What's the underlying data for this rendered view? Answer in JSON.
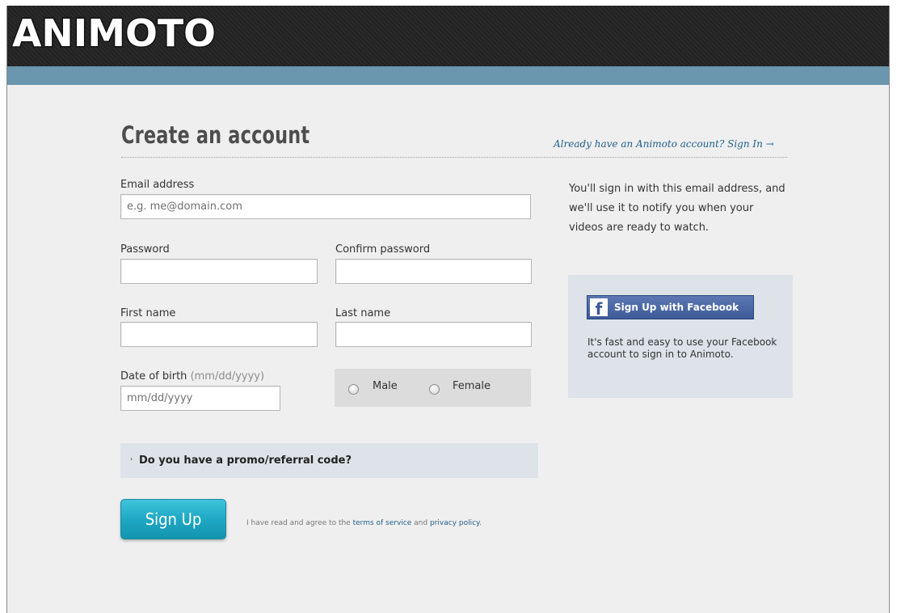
{
  "header": {
    "logo_text": "ANIMOTO"
  },
  "form": {
    "title": "Create an account",
    "signin_link": "Already have an Animoto account? Sign In →",
    "email": {
      "label": "Email address",
      "placeholder": "e.g. me@domain.com"
    },
    "password": {
      "label": "Password",
      "value": ""
    },
    "confirm_password": {
      "label": "Confirm password",
      "value": ""
    },
    "first_name": {
      "label": "First name",
      "value": ""
    },
    "last_name": {
      "label": "Last name",
      "value": ""
    },
    "dob": {
      "label": "Date of birth",
      "hint": "(mm/dd/yyyy)",
      "placeholder": "mm/dd/yyyy"
    },
    "gender": {
      "male": "Male",
      "female": "Female"
    },
    "promo": {
      "arrow": "›",
      "label": "Do you have a promo/referral code?"
    },
    "signup_button": "Sign Up",
    "agreement": {
      "prefix": "I have read and agree to the",
      "terms": "terms of service",
      "and": "and",
      "privacy": "privacy policy",
      "suffix": "."
    }
  },
  "sidebar": {
    "help_text": "You'll sign in with this email address, and we'll use it to notify you when your videos are ready to watch.",
    "facebook": {
      "icon": "facebook-icon",
      "button_label": "Sign Up with Facebook",
      "description": "It's fast and easy to use your Facebook account to sign in to Animoto."
    }
  },
  "colors": {
    "header_bg": "#262626",
    "accent_strip": "#6a96ae",
    "signup_button": "#1ea8c4",
    "link": "#1f5f8c",
    "facebook": "#3b5998"
  }
}
